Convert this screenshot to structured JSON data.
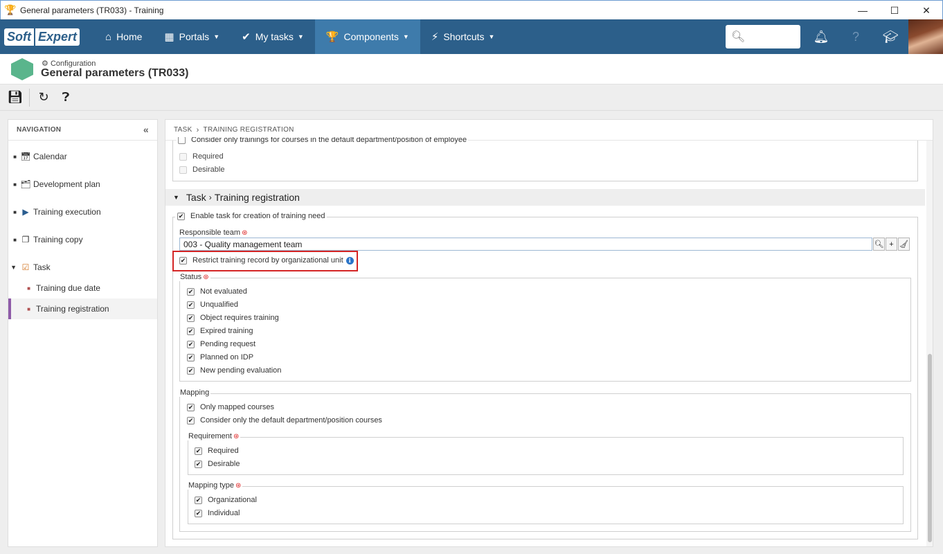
{
  "window": {
    "title": "General parameters (TR033) - Training",
    "minimize": "—",
    "maximize": "☐",
    "close": "✕"
  },
  "navbar": {
    "logo_soft": "Soft",
    "logo_expert": "Expert",
    "items": [
      {
        "label": "Home",
        "icon": "home-icon"
      },
      {
        "label": "Portals",
        "icon": "grid-icon"
      },
      {
        "label": "My tasks",
        "icon": "check-icon"
      },
      {
        "label": "Components",
        "icon": "trophy-icon"
      },
      {
        "label": "Shortcuts",
        "icon": "bolt-icon"
      }
    ],
    "active_index": 3,
    "search_placeholder": ""
  },
  "header": {
    "breadcrumb": "Configuration",
    "title": "General parameters (TR033)"
  },
  "navigation": {
    "heading": "NAVIGATION",
    "items": [
      {
        "label": "Calendar",
        "icon": "calendar-icon"
      },
      {
        "label": "Development plan",
        "icon": "development-plan-icon"
      },
      {
        "label": "Training execution",
        "icon": "training-execution-icon"
      },
      {
        "label": "Training copy",
        "icon": "copy-icon"
      },
      {
        "label": "Task",
        "icon": "task-icon"
      }
    ],
    "subitems": [
      "Training due date",
      "Training registration"
    ],
    "selected": "Training registration"
  },
  "content": {
    "breadcrumb": [
      "TASK",
      "TRAINING REGISTRATION"
    ],
    "prev_group": {
      "legend": "Consider only trainings for courses in the default department/position of employee",
      "options": [
        "Required",
        "Desirable"
      ]
    },
    "section": {
      "part1": "Task",
      "arrow": "›",
      "part2": "Training registration"
    },
    "enable_task": "Enable task for creation of training need",
    "responsible_team_label": "Responsible team",
    "responsible_team_value": "003 - Quality management team",
    "restrict_label": "Restrict training record by organizational unit",
    "status": {
      "legend": "Status",
      "options": [
        "Not evaluated",
        "Unqualified",
        "Object requires training",
        "Expired training",
        "Pending request",
        "Planned on IDP",
        "New pending evaluation"
      ]
    },
    "mapping": {
      "legend": "Mapping",
      "options": [
        "Only mapped courses",
        "Consider only the default department/position courses"
      ],
      "requirement": {
        "legend": "Requirement",
        "options": [
          "Required",
          "Desirable"
        ]
      },
      "mapping_type": {
        "legend": "Mapping type",
        "options": [
          "Organizational",
          "Individual"
        ]
      }
    }
  },
  "colors": {
    "navbar": "#2c5f8a",
    "navbar_active": "#3e7bab",
    "highlight": "#d42525",
    "selected_bar": "#8e5ba8"
  }
}
